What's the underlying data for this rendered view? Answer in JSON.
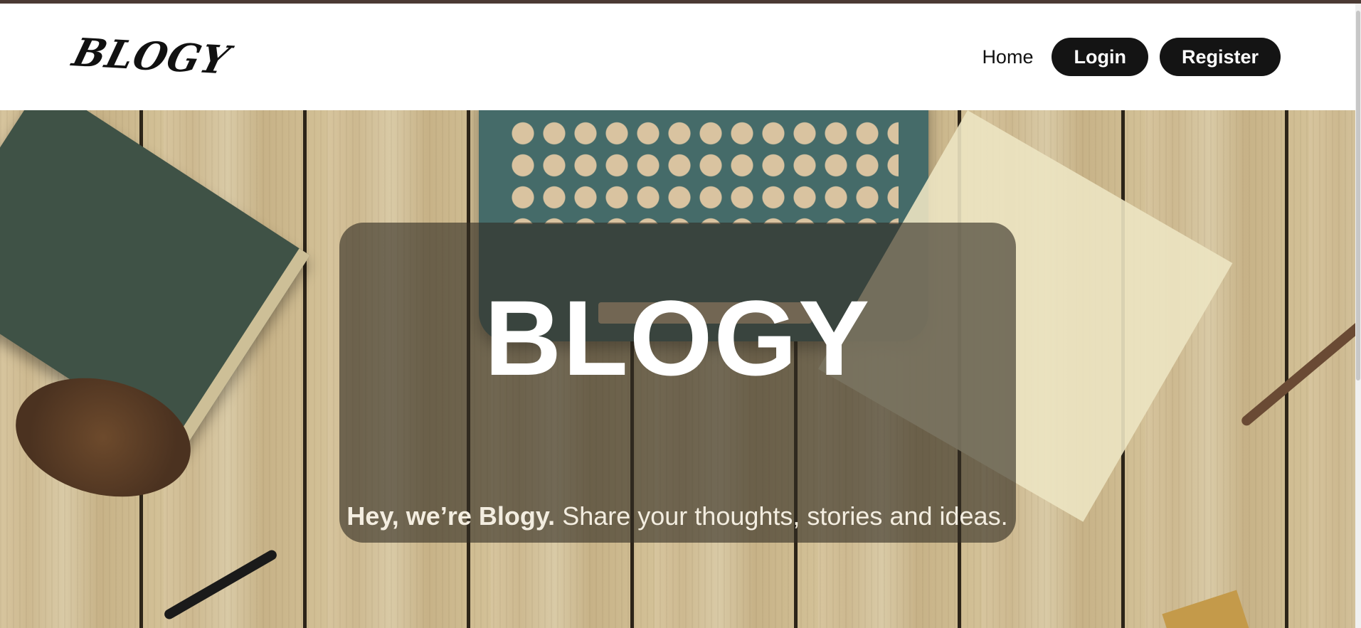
{
  "navbar": {
    "logo_text": "BLOGY",
    "links": {
      "home": "Home",
      "login": "Login",
      "register": "Register"
    }
  },
  "hero": {
    "title": "BLOGY",
    "tagline_bold": "Hey, we’re Blogy.",
    "tagline_rest": " Share your thoughts, stories and ideas."
  },
  "colors": {
    "accent_bar": "#4b3a34",
    "button_bg": "#141414",
    "button_text": "#ffffff",
    "hero_overlay": "rgba(50,45,35,0.62)"
  }
}
